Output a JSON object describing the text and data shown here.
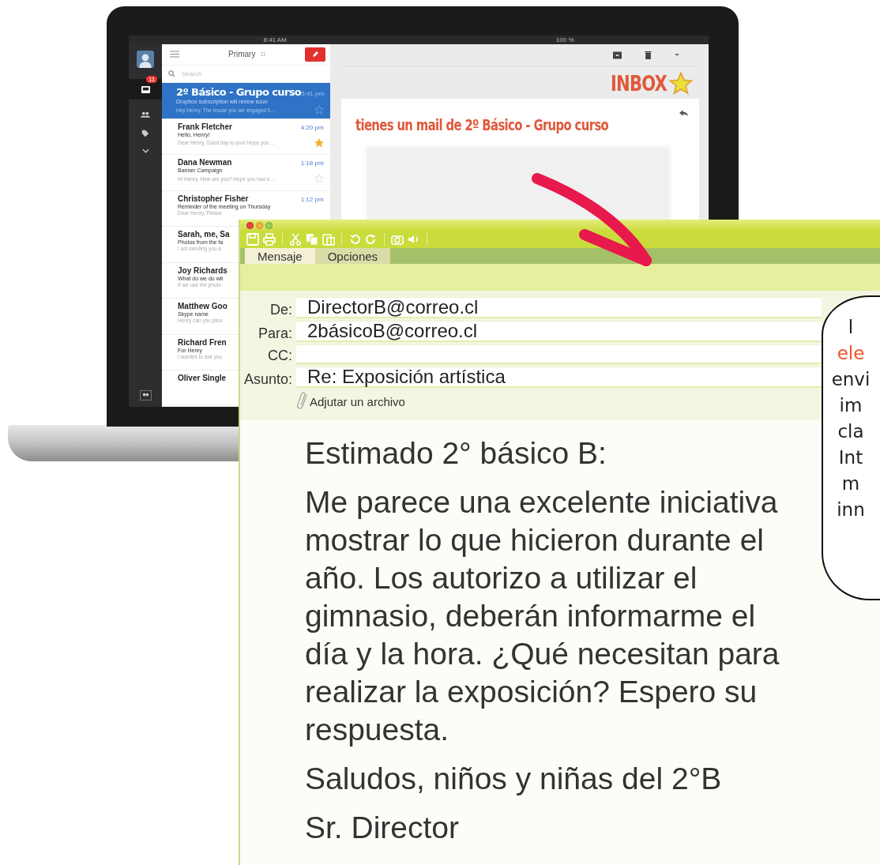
{
  "laptop": {
    "status_bar": {
      "time": "8:41 AM",
      "battery": "100 %"
    },
    "sidebar": {
      "inbox_badge": "11"
    },
    "mail_list": {
      "title": "Primary",
      "count": "11",
      "search": {
        "placeholder": "Search"
      },
      "messages": [
        {
          "sender": "2º Básico - Grupo curso",
          "time": "5:41 pm",
          "subject": "Dropbox subscription will renew soon",
          "snippet": "Hey Henry, The house you we engaged h...",
          "selected": true,
          "starred": false
        },
        {
          "sender": "Frank Fletcher",
          "time": "4:20 pm",
          "subject": "Hello, Henry!",
          "snippet": "Dear Henry, Good day to you! Hope you ...",
          "selected": false,
          "starred": true
        },
        {
          "sender": "Dana Newman",
          "time": "1:18 pm",
          "subject": "Banner Campaign",
          "snippet": "Hi Henry, How are you? Hope you had a ...",
          "selected": false,
          "starred": false
        },
        {
          "sender": "Christopher Fisher",
          "time": "1:12 pm",
          "subject": "Reminder of the meeting on Thursday",
          "snippet": "Dear Henry, Please",
          "selected": false
        },
        {
          "sender": "Sarah, me, Sa",
          "subject": "Photos from the fa",
          "snippet": "I am sending you a",
          "selected": false
        },
        {
          "sender": "Joy Richards",
          "subject": "What do we do wit",
          "snippet": "If we use the photo",
          "selected": false
        },
        {
          "sender": "Matthew Goo",
          "subject": "Skype name",
          "snippet": "Henry can you plea",
          "selected": false
        },
        {
          "sender": "Richard Fren",
          "subject": "For Henry",
          "snippet": "I wanted to ask you",
          "selected": false
        },
        {
          "sender": "Oliver Single",
          "selected": false
        }
      ]
    },
    "reading_pane": {
      "heading": "INBOX",
      "message_title": "tienes un mail de 2º Básico - Grupo curso"
    }
  },
  "compose": {
    "tabs": [
      {
        "label": "Mensaje",
        "selected": true
      },
      {
        "label": "Opciones",
        "selected": false
      }
    ],
    "fields": [
      {
        "label": "De:",
        "value": "DirectorB@correo.cl"
      },
      {
        "label": "Para:",
        "value": "2básicoB@correo.cl"
      },
      {
        "label": "CC:"
      },
      {
        "label": "Asunto:",
        "value": "Re: Exposición artística"
      }
    ],
    "attachment": "Adjutar un archivo",
    "body": [
      "Estimado 2° básico B:",
      "Me parece una excelente iniciativa mostrar lo que hicieron durante el año. Los autorizo a utilizar el gimnasio, deberán informarme el día y la hora. ¿Qué necesitan para realizar la exposición? Espero su respuesta.",
      "Saludos, niños y niñas del 2°B",
      "Sr. Director"
    ]
  },
  "callout": {
    "lines": [
      {
        "text": "l",
        "highlight": false
      },
      {
        "text": "ele",
        "highlight": true
      },
      {
        "text": "envi",
        "highlight": false
      },
      {
        "text": "im",
        "highlight": false
      },
      {
        "text": "cla",
        "highlight": false
      },
      {
        "text": "Int",
        "highlight": false
      },
      {
        "text": "m",
        "highlight": false
      },
      {
        "text": "inn",
        "highlight": false
      }
    ]
  }
}
